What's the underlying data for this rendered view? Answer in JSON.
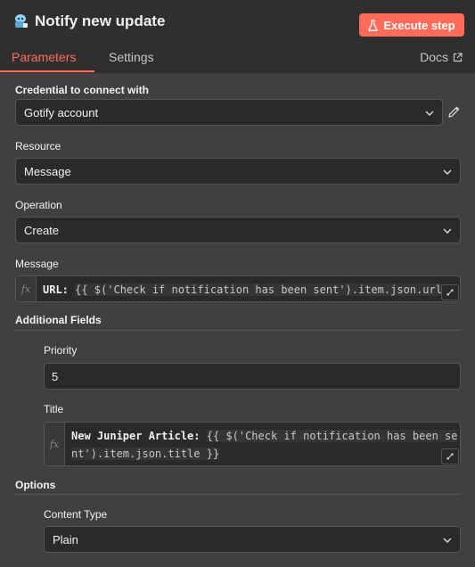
{
  "header": {
    "title": "Notify new update",
    "execute_label": "Execute step",
    "icon": "gotify-node-icon"
  },
  "tabs": [
    {
      "label": "Parameters",
      "active": true
    },
    {
      "label": "Settings",
      "active": false
    }
  ],
  "docs_label": "Docs",
  "credential": {
    "label": "Credential to connect with",
    "value": "Gotify account"
  },
  "resource": {
    "label": "Resource",
    "value": "Message"
  },
  "operation": {
    "label": "Operation",
    "value": "Create"
  },
  "message": {
    "label": "Message",
    "prefix": "URL: ",
    "expression": "{{ $('Check if notification has been sent').item.json.url"
  },
  "additional_fields": {
    "label": "Additional Fields",
    "priority": {
      "label": "Priority",
      "value": "5"
    },
    "title": {
      "label": "Title",
      "prefix": "New Juniper Article: ",
      "expr_line1": "{{ $('Check if notification has been se",
      "expr_line2": "nt').item.json.title }}"
    }
  },
  "options": {
    "label": "Options",
    "content_type": {
      "label": "Content Type",
      "value": "Plain"
    }
  },
  "colors": {
    "accent": "#ff6d5a",
    "panel": "#404040",
    "header": "#2f2f2f",
    "field": "#2a2a2a"
  }
}
